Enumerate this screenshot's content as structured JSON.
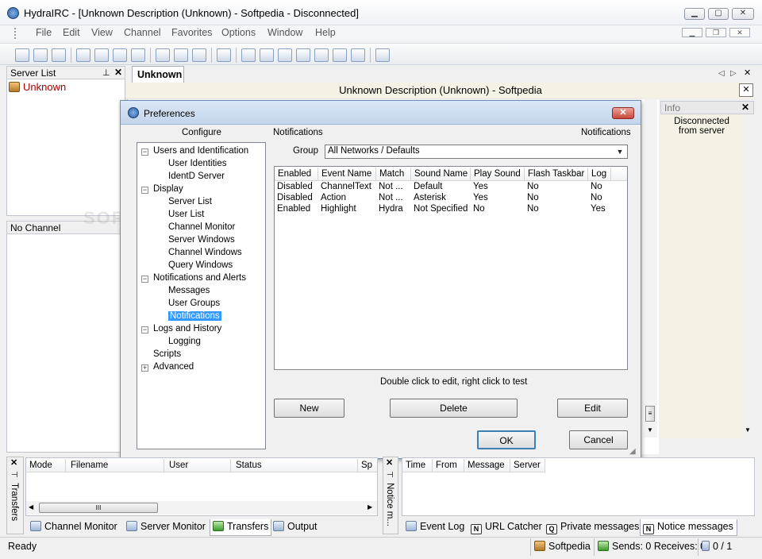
{
  "window": {
    "title": "HydraIRC - [Unknown Description (Unknown) - Softpedia - Disconnected]"
  },
  "menu": [
    "File",
    "Edit",
    "View",
    "Channel",
    "Favorites",
    "Options",
    "Window",
    "Help"
  ],
  "server_list": {
    "header": "Server List",
    "items": [
      {
        "label": "Unknown"
      }
    ]
  },
  "channel_panel": {
    "header": "No Channel"
  },
  "document": {
    "tab_label": "Unknown",
    "title": "Unknown Description (Unknown) - Softpedia"
  },
  "info_panel": {
    "header": "Info",
    "text": "Disconnected from server"
  },
  "preferences": {
    "title": "Preferences",
    "configure_label": "Configure",
    "section_title": "Notifications",
    "section_title_right": "Notifications",
    "group_label": "Group",
    "group_value": "All Networks / Defaults",
    "tree": [
      {
        "label": "Users and Identification",
        "level": 0,
        "expander": "−"
      },
      {
        "label": "User Identities",
        "level": 1
      },
      {
        "label": "IdentD Server",
        "level": 1
      },
      {
        "label": "Display",
        "level": 0,
        "expander": "−"
      },
      {
        "label": "Server List",
        "level": 1
      },
      {
        "label": "User List",
        "level": 1
      },
      {
        "label": "Channel Monitor",
        "level": 1
      },
      {
        "label": "Server Windows",
        "level": 1
      },
      {
        "label": "Channel Windows",
        "level": 1
      },
      {
        "label": "Query Windows",
        "level": 1
      },
      {
        "label": "Notifications and Alerts",
        "level": 0,
        "expander": "−"
      },
      {
        "label": "Messages",
        "level": 1
      },
      {
        "label": "User Groups",
        "level": 1
      },
      {
        "label": "Notifications",
        "level": 1,
        "selected": true
      },
      {
        "label": "Logs and History",
        "level": 0,
        "expander": "−"
      },
      {
        "label": "Logging",
        "level": 1
      },
      {
        "label": "Scripts",
        "level": 0
      },
      {
        "label": "Advanced",
        "level": 0,
        "expander": "+"
      }
    ],
    "columns": [
      "Enabled",
      "Event Name",
      "Match",
      "Sound Name",
      "Play Sound",
      "Flash Taskbar",
      "Log"
    ],
    "rows": [
      [
        "Disabled",
        "ChannelText",
        "Not ...",
        "Default",
        "Yes",
        "No",
        "No"
      ],
      [
        "Disabled",
        "Action",
        "Not ...",
        "Asterisk",
        "Yes",
        "No",
        "No"
      ],
      [
        "Enabled",
        "Highlight",
        "Hydra",
        "Not Specified",
        "No",
        "No",
        "Yes"
      ]
    ],
    "hint": "Double click to edit, right click to test",
    "buttons": {
      "new": "New",
      "delete": "Delete",
      "edit": "Edit",
      "ok": "OK",
      "cancel": "Cancel"
    }
  },
  "transfers": {
    "columns": [
      "Mode",
      "Filename",
      "User",
      "Status",
      "Sp"
    ],
    "side_label": "Transfers",
    "tabs": [
      "Channel Monitor",
      "Server Monitor",
      "Transfers",
      "Output"
    ],
    "scroll_label": "III"
  },
  "notices": {
    "columns": [
      "Time",
      "From",
      "Message",
      "Server"
    ],
    "side_label": "Notice m...",
    "tabs": [
      "Event Log",
      "URL Catcher",
      "Private messages",
      "Notice messages"
    ],
    "tab_glyphs": [
      "",
      "N",
      "Q",
      "N"
    ]
  },
  "status": {
    "ready": "Ready",
    "network": "Softpedia",
    "traffic": "Sends: 0 Receives: 0",
    "count": "0 / 1"
  }
}
